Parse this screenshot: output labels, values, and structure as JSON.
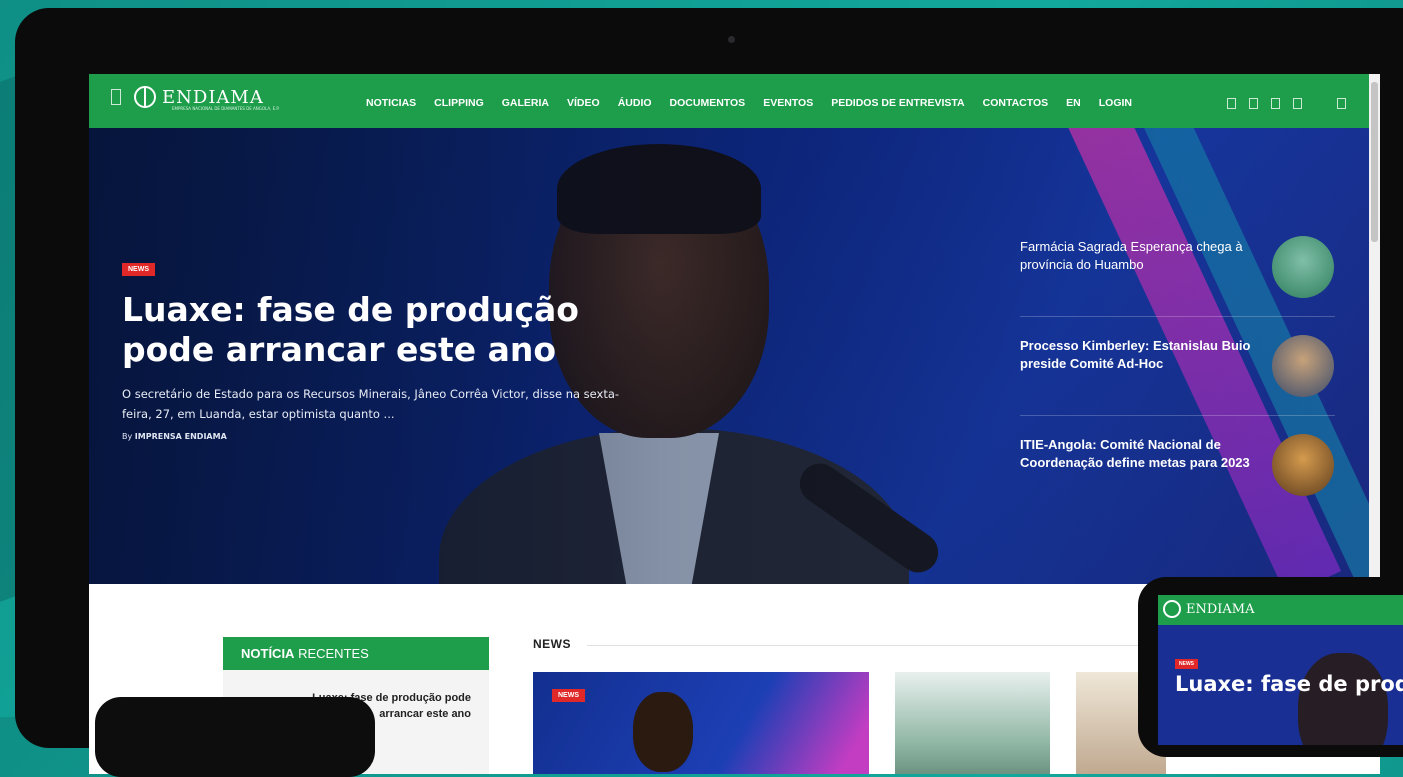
{
  "nav": {
    "logo_text": "ENDIAMA",
    "logo_subtitle": "EMPRESA NACIONAL DE DIAMANTES DE ANGOLA, E.P.",
    "items": [
      "NOTICIAS",
      "CLIPPING",
      "GALERIA",
      "VÍDEO",
      "ÁUDIO",
      "DOCUMENTOS",
      "EVENTOS",
      "PEDIDOS DE ENTREVISTA",
      "CONTACTOS",
      "EN",
      "LOGIN"
    ]
  },
  "hero": {
    "badge": "NEWS",
    "title": "Luaxe: fase de produção pode arrancar este ano",
    "excerpt": "O secretário de Estado para os Recursos Minerais, Jâneo Corrêa Victor, disse na sexta-feira, 27, em Luanda, estar optimista quanto ...",
    "by_prefix": "By",
    "author": "IMPRENSA ENDIAMA",
    "side": [
      {
        "title": "Farmácia Sagrada Esperança chega à província do Huambo"
      },
      {
        "title": "Processo Kimberley: Estanislau Buio preside Comité Ad-Hoc"
      },
      {
        "title": "ITIE-Angola: Comité Nacional de Coordenação define metas para 2023"
      }
    ]
  },
  "recent": {
    "heading_bold": "NOTÍCIA",
    "heading_rest": " RECENTES",
    "item_title": "Luaxe: fase de produção pode arrancar este ano"
  },
  "news": {
    "heading": "NEWS",
    "badge": "NEWS"
  },
  "tablet": {
    "logo_text": "ENDIAMA",
    "badge": "NEWS",
    "title": "Luaxe: fase de prod"
  }
}
